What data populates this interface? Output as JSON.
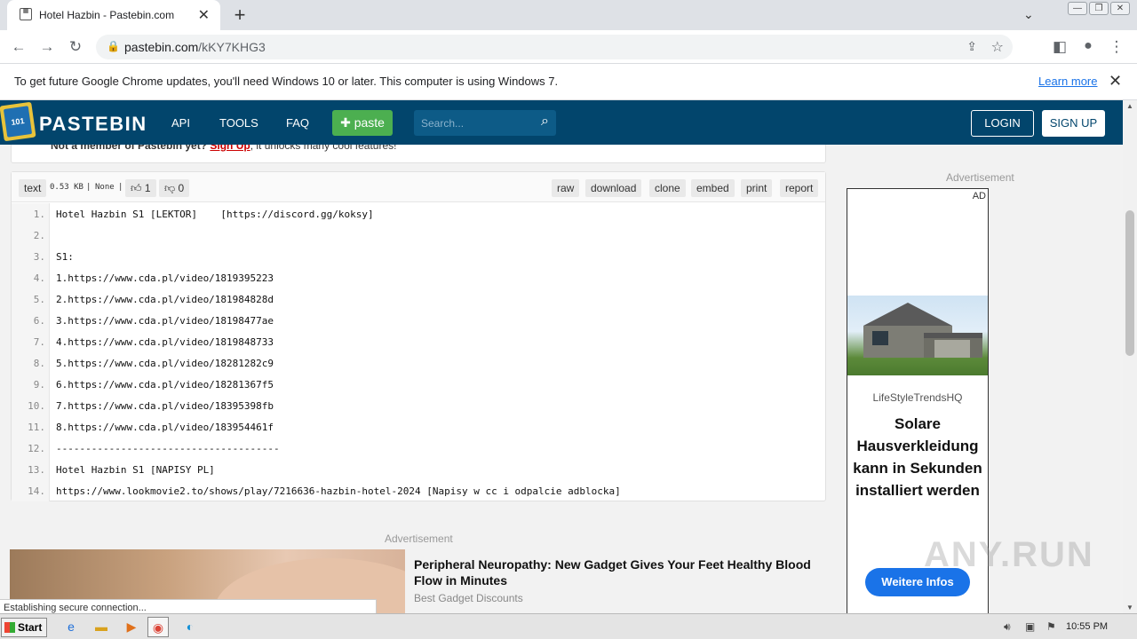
{
  "browser": {
    "tab_title": "Hotel Hazbin - Pastebin.com",
    "url_domain": "pastebin.com",
    "url_path": "/kKY7KHG3",
    "infobar_message": "To get future Google Chrome updates, you'll need Windows 10 or later. This computer is using Windows 7.",
    "infobar_link": "Learn more"
  },
  "site": {
    "brand": "PASTEBIN",
    "logo_text": "101",
    "nav": [
      "API",
      "TOOLS",
      "FAQ"
    ],
    "paste_button": "paste",
    "search_placeholder": "Search...",
    "login": "LOGIN",
    "signup": "SIGN UP",
    "notice_bold": "Not a member of Pastebin yet?",
    "notice_link": "Sign Up",
    "notice_rest": ", it unlocks many cool features!"
  },
  "paste": {
    "syntax": "text",
    "size": "0.53 KB",
    "sep1": "|",
    "expiry": "None",
    "sep2": "|",
    "likes": "1",
    "dislikes": "0",
    "actions": [
      "raw",
      "download",
      "clone",
      "embed",
      "print",
      "report"
    ],
    "lines": [
      {
        "n": "1.",
        "text": "Hotel Hazbin S1 [LEKTOR]    [https://discord.gg/koksy]"
      },
      {
        "n": "2.",
        "text": ""
      },
      {
        "n": "3.",
        "text": "S1:"
      },
      {
        "n": "4.",
        "text": "1.https://www.cda.pl/video/1819395223"
      },
      {
        "n": "5.",
        "text": "2.https://www.cda.pl/video/181984828d"
      },
      {
        "n": "6.",
        "text": "3.https://www.cda.pl/video/18198477ae"
      },
      {
        "n": "7.",
        "text": "4.https://www.cda.pl/video/1819848733"
      },
      {
        "n": "8.",
        "text": "5.https://www.cda.pl/video/18281282c9"
      },
      {
        "n": "9.",
        "text": "6.https://www.cda.pl/video/18281367f5"
      },
      {
        "n": "10.",
        "text": "7.https://www.cda.pl/video/18395398fb"
      },
      {
        "n": "11.",
        "text": "8.https://www.cda.pl/video/183954461f"
      },
      {
        "n": "12.",
        "text": "--------------------------------------"
      },
      {
        "n": "13.",
        "text": "Hotel Hazbin S1 [NAPISY PL]"
      },
      {
        "n": "14.",
        "text": "https://www.lookmovie2.to/shows/play/7216636-hazbin-hotel-2024 [Napisy w cc i odpalcie adblocka]"
      }
    ]
  },
  "ads": {
    "bottom_label": "Advertisement",
    "bottom_headline": "Peripheral Neuropathy: New Gadget Gives Your Feet Healthy Blood Flow in Minutes",
    "bottom_source": "Best Gadget Discounts",
    "side_label": "Advertisement",
    "side_badge": "AD",
    "side_brand": "LifeStyleTrendsHQ",
    "side_headline": "Solare Hausverkleidung kann in Sekunden installiert werden",
    "side_cta": "Weitere Infos"
  },
  "status_text": "Establishing secure connection...",
  "watermark": "ANY.RUN",
  "taskbar": {
    "start": "Start",
    "time": "10:55 PM"
  },
  "colors": {
    "pastebin_header": "#02456c",
    "paste_green": "#4caf50",
    "cta_blue": "#1a73e8"
  }
}
